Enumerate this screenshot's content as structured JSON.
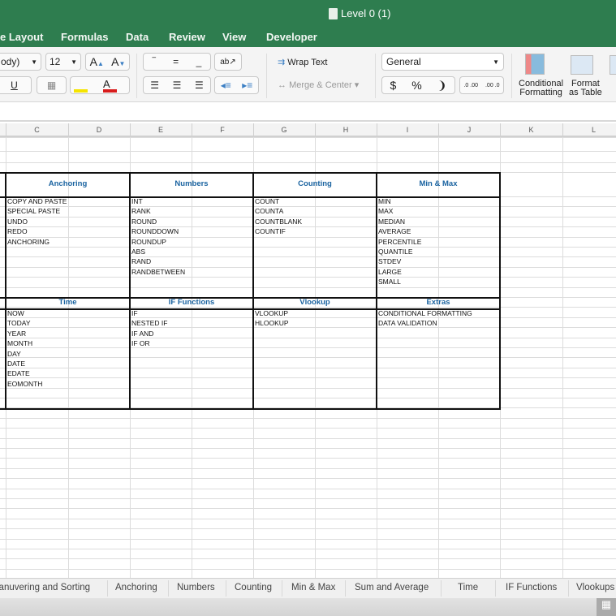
{
  "window": {
    "title": "Level 0 (1)"
  },
  "menu": [
    "e Layout",
    "Formulas",
    "Data",
    "Review",
    "View",
    "Developer"
  ],
  "ribbon": {
    "font_name": "ody)",
    "font_size": "12",
    "wrap_text": "Wrap Text",
    "merge_center": "Merge & Center",
    "number_format": "General",
    "currency": "$",
    "percent": "%",
    "comma": "❩",
    "inc_decimal": ".0 .00",
    "dec_decimal": ".00 .0",
    "conditional_formatting": [
      "Conditional",
      "Formatting"
    ],
    "format_as_table": [
      "Format",
      "as Table"
    ],
    "colors": {
      "highlight": "#f5e400",
      "font": "#d81c1c"
    }
  },
  "columns": [
    "C",
    "D",
    "E",
    "F",
    "G",
    "H",
    "I",
    "J",
    "K",
    "L"
  ],
  "sections": [
    {
      "row": "top",
      "groups": [
        {
          "title": "Anchoring",
          "items": [
            "COPY AND PASTE",
            "SPECIAL PASTE",
            "UNDO",
            "REDO",
            "ANCHORING"
          ]
        },
        {
          "title": "Numbers",
          "items": [
            "INT",
            "RANK",
            "ROUND",
            "ROUNDDOWN",
            "ROUNDUP",
            "ABS",
            "RAND",
            "RANDBETWEEN"
          ]
        },
        {
          "title": "Counting",
          "items": [
            "COUNT",
            "COUNTA",
            "COUNTBLANK",
            "COUNTIF"
          ]
        },
        {
          "title": "Min & Max",
          "items": [
            "MIN",
            "MAX",
            "MEDIAN",
            "AVERAGE",
            "PERCENTILE",
            "QUANTILE",
            "STDEV",
            "LARGE",
            "SMALL"
          ]
        }
      ]
    },
    {
      "row": "bottom",
      "groups": [
        {
          "title": "Time",
          "items": [
            "NOW",
            "TODAY",
            "YEAR",
            "MONTH",
            "DAY",
            "DATE",
            "EDATE",
            "EOMONTH"
          ]
        },
        {
          "title": "IF Functions",
          "items": [
            "IF",
            "NESTED IF",
            "IF AND",
            "IF OR"
          ]
        },
        {
          "title": "Vlookup",
          "items": [
            "VLOOKUP",
            "HLOOKUP"
          ]
        },
        {
          "title": "Extras",
          "items": [
            "CONDITIONAL FORMATTING",
            "DATA VALIDATION"
          ]
        }
      ]
    }
  ],
  "sheet_tabs": [
    "lanuvering and Sorting",
    "Anchoring",
    "Numbers",
    "Counting",
    "Min & Max",
    "Sum and Average",
    "Time",
    "IF Functions",
    "Vlookups"
  ],
  "accent": "#2e7d4f",
  "header_color": "#1a63a0"
}
